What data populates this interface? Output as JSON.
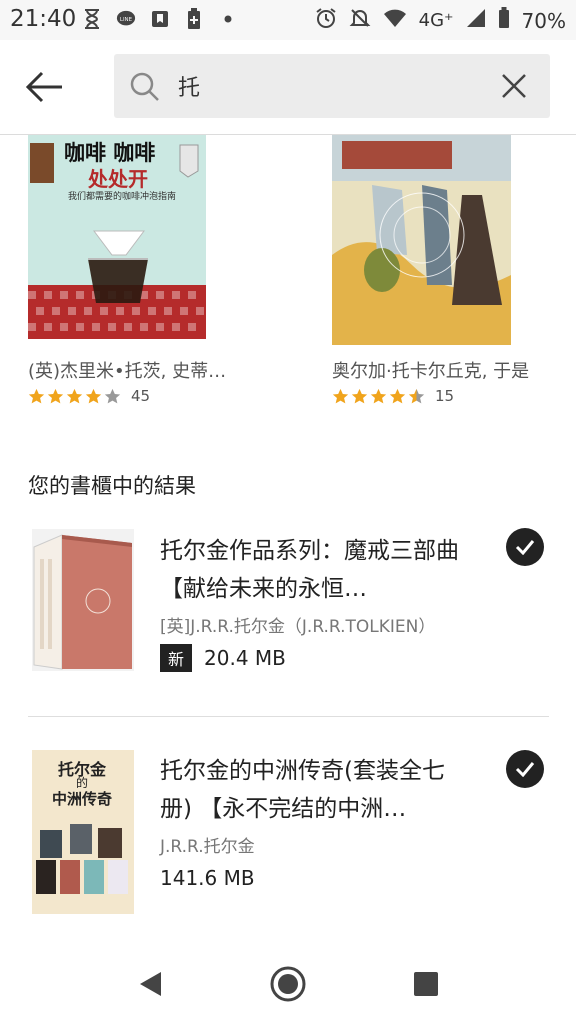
{
  "status_bar": {
    "time": "21:40",
    "network": "4G⁺",
    "battery": "70%",
    "left_icons": [
      "hourglass-icon",
      "line-icon",
      "bookmark-icon",
      "battery-saver-icon",
      "dot-icon"
    ],
    "right_icons": [
      "alarm-icon",
      "mute-icon",
      "wifi-icon",
      "signal-icon",
      "battery-icon"
    ]
  },
  "search": {
    "query": "托"
  },
  "recommendations": [
    {
      "cover_title_1": "咖啡 咖啡",
      "cover_title_2": "处处开",
      "cover_subtitle": "我们都需要的咖啡冲泡指南",
      "author": "(英)杰里米•托茨, 史蒂…",
      "rating": 4.0,
      "rating_count": "45"
    },
    {
      "author": "奥尔加·托卡尔丘克, 于是",
      "rating": 4.5,
      "rating_count": "15"
    }
  ],
  "library_section": {
    "title": "您的書櫃中的結果",
    "items": [
      {
        "title": "托尔金作品系列：魔戒三部曲 【献给未来的永恒…",
        "author": "[英]J.R.R.托尔金（J.R.R.TOLKIEN）",
        "badge": "新",
        "size": "20.4 MB"
      },
      {
        "cover_title_1": "托尔金",
        "cover_title_2": "的",
        "cover_title_3": "中洲传奇",
        "title": "托尔金的中洲传奇(套装全七册) 【永不完结的中洲…",
        "author": "J.R.R.托尔金",
        "size": "141.6 MB"
      }
    ]
  },
  "colors": {
    "accent_star": "#f0a41c",
    "check_bg": "#222222",
    "search_bg": "#ececec"
  }
}
